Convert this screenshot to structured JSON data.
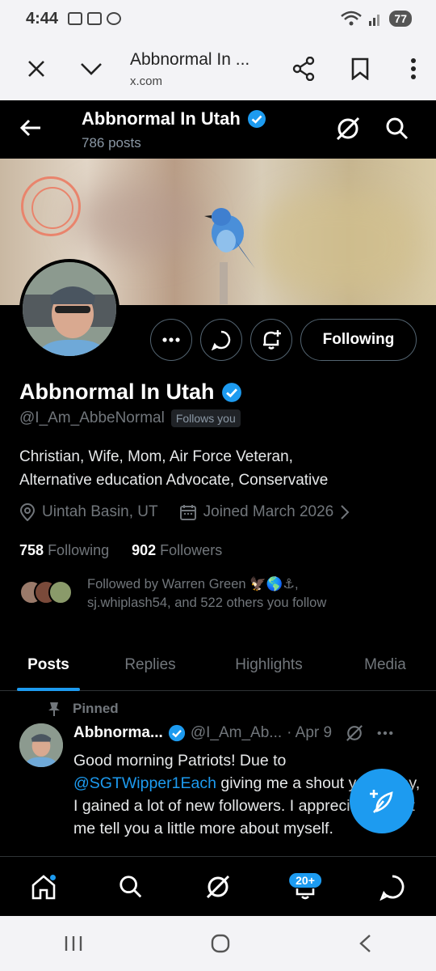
{
  "status_bar": {
    "time": "4:44",
    "battery": "77"
  },
  "browser": {
    "title": "Abbnormal In ...",
    "url": "x.com"
  },
  "header": {
    "title": "Abbnormal In Utah",
    "post_count": "786 posts"
  },
  "profile": {
    "display_name": "Abbnormal In Utah",
    "handle": "@I_Am_AbbeNormal",
    "follows_you_badge": "Follows you",
    "follow_button_label": "Following",
    "bio_line1": "Christian, Wife, Mom, Air Force Veteran,",
    "bio_line2": "Alternative education Advocate, Conservative",
    "location": "Uintah Basin, UT",
    "joined": "Joined March 2026",
    "following_count": "758",
    "following_label": "Following",
    "followers_count": "902",
    "followers_label": "Followers",
    "followed_by_line1": "Followed by Warren Green 🦅🌎⚓,",
    "followed_by_line2": "sj.whiplash54, and 522 others you follow"
  },
  "tabs": [
    {
      "label": "Posts",
      "active": true
    },
    {
      "label": "Replies",
      "active": false
    },
    {
      "label": "Highlights",
      "active": false
    },
    {
      "label": "Media",
      "active": false
    }
  ],
  "pinned_post": {
    "pinned_label": "Pinned",
    "author": "Abbnorma...",
    "handle": "@I_Am_Ab...",
    "date": "· Apr 9",
    "text_part1": "Good morning Patriots! Due to ",
    "mention": "@SGTWipper1Each",
    "text_part2": " giving me a shout yesterday, I gained a lot of new followers. I appreciate it! Let me tell you a little more about myself."
  },
  "bottom_nav": {
    "notifications_badge": "20+"
  },
  "colors": {
    "accent": "#1d9bf0",
    "background": "#000000",
    "muted_text": "#71767b"
  }
}
